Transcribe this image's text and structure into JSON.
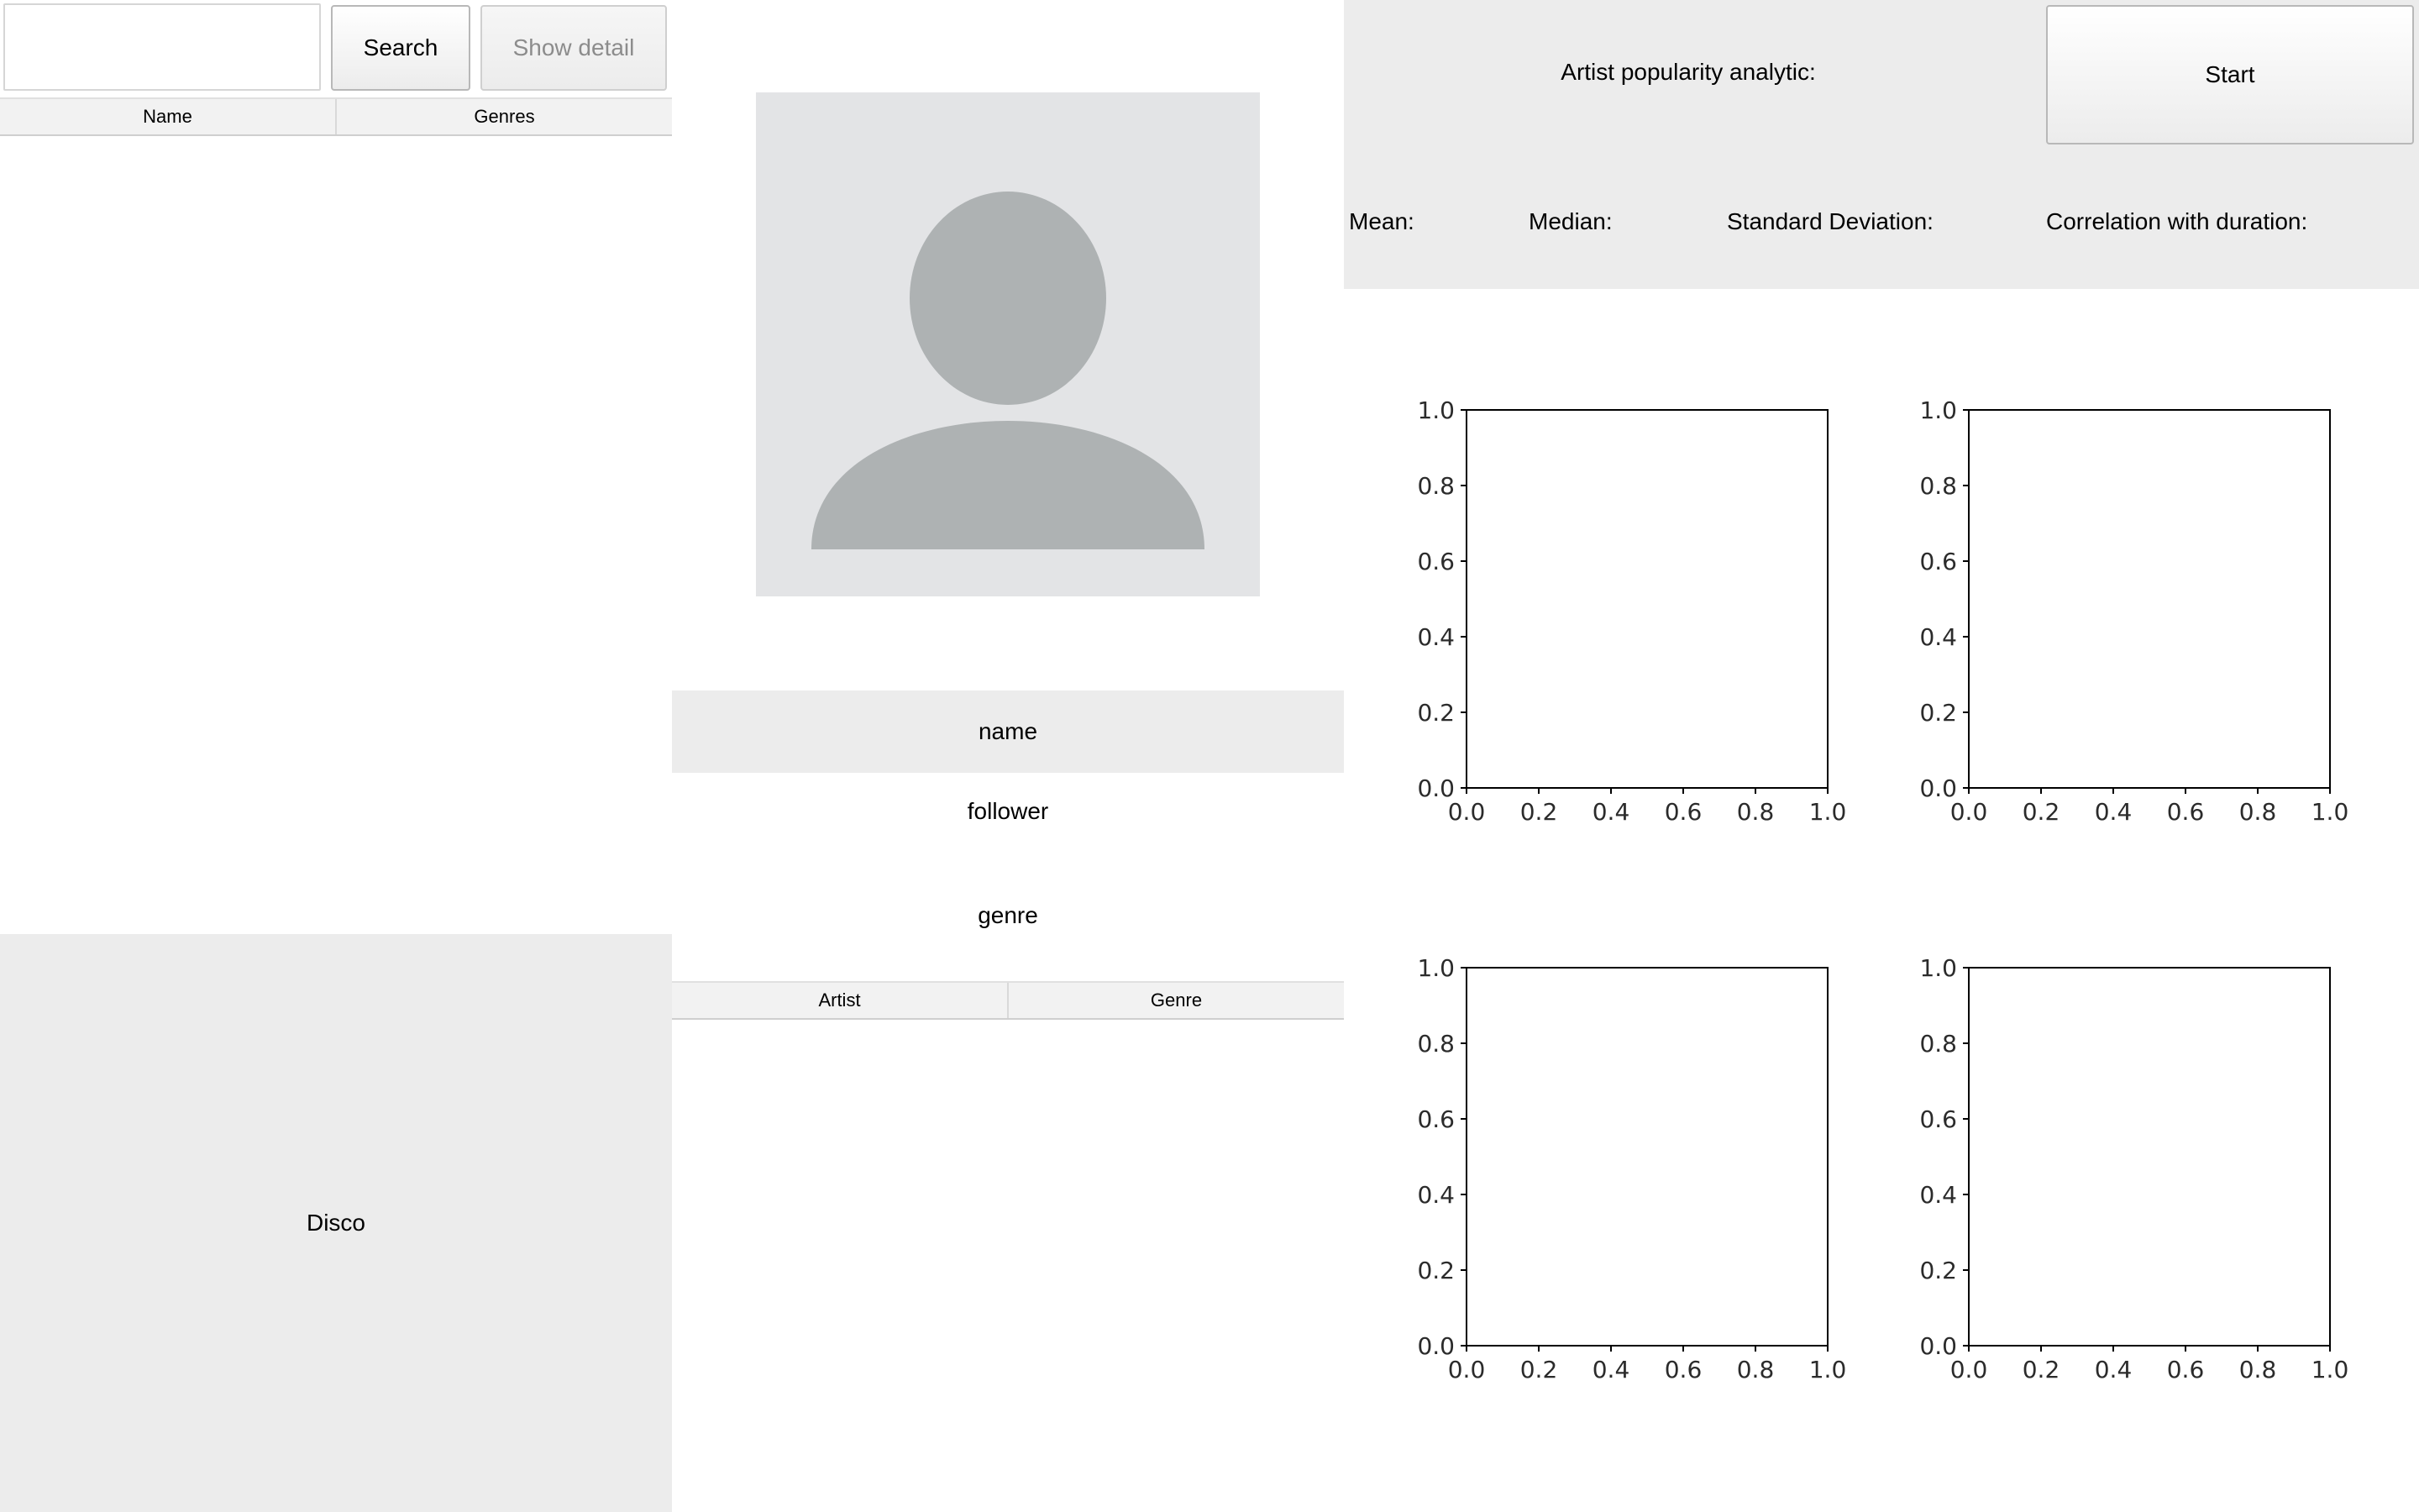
{
  "search": {
    "placeholder": "",
    "value": "",
    "button_label": "Search",
    "detail_label": "Show detail"
  },
  "artist_table": {
    "columns": [
      "Name",
      "Genres"
    ]
  },
  "genre_panel": {
    "label": "Disco"
  },
  "artist_detail": {
    "name_label": "name",
    "follower_label": "follower",
    "genre_label": "genre"
  },
  "artist_genre_table": {
    "columns": [
      "Artist",
      "Genre"
    ]
  },
  "analytics": {
    "title": "Artist popularity analytic:",
    "start_label": "Start",
    "mean_label": "Mean:",
    "median_label": "Median:",
    "std_label": "Standard Deviation:",
    "corr_label": "Correlation with duration:"
  },
  "chart_data": [
    {
      "type": "scatter",
      "title": "",
      "xlabel": "",
      "ylabel": "",
      "xlim": [
        0,
        1
      ],
      "ylim": [
        0,
        1
      ],
      "xticks": [
        0.0,
        0.2,
        0.4,
        0.6,
        0.8,
        1.0
      ],
      "yticks": [
        0.0,
        0.2,
        0.4,
        0.6,
        0.8,
        1.0
      ],
      "series": []
    },
    {
      "type": "scatter",
      "title": "",
      "xlabel": "",
      "ylabel": "",
      "xlim": [
        0,
        1
      ],
      "ylim": [
        0,
        1
      ],
      "xticks": [
        0.0,
        0.2,
        0.4,
        0.6,
        0.8,
        1.0
      ],
      "yticks": [
        0.0,
        0.2,
        0.4,
        0.6,
        0.8,
        1.0
      ],
      "series": []
    },
    {
      "type": "scatter",
      "title": "",
      "xlabel": "",
      "ylabel": "",
      "xlim": [
        0,
        1
      ],
      "ylim": [
        0,
        1
      ],
      "xticks": [
        0.0,
        0.2,
        0.4,
        0.6,
        0.8,
        1.0
      ],
      "yticks": [
        0.0,
        0.2,
        0.4,
        0.6,
        0.8,
        1.0
      ],
      "series": []
    },
    {
      "type": "scatter",
      "title": "",
      "xlabel": "",
      "ylabel": "",
      "xlim": [
        0,
        1
      ],
      "ylim": [
        0,
        1
      ],
      "xticks": [
        0.0,
        0.2,
        0.4,
        0.6,
        0.8,
        1.0
      ],
      "yticks": [
        0.0,
        0.2,
        0.4,
        0.6,
        0.8,
        1.0
      ],
      "series": []
    }
  ]
}
